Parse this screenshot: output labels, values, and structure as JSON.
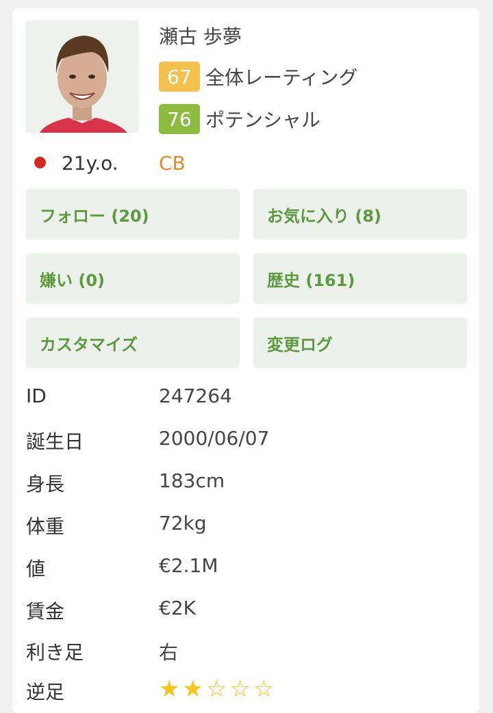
{
  "player": {
    "name": "瀬古 歩夢",
    "overall": "67",
    "overall_label": "全体レーティング",
    "potential": "76",
    "potential_label": "ポテンシャル",
    "age": "21y.o.",
    "position": "CB"
  },
  "colors": {
    "overall_badge": "#f2c14e",
    "potential_badge": "#8dbb3f",
    "position": "#e08a2e",
    "nation_dot": "#d2281e",
    "button_text": "#5c9a3e",
    "star": "#f5c518"
  },
  "buttons": [
    {
      "label": "フォロー (20)"
    },
    {
      "label": "お気に入り (8)"
    },
    {
      "label": "嫌い (0)"
    },
    {
      "label": "歴史 (161)"
    },
    {
      "label": "カスタマイズ"
    },
    {
      "label": "変更ログ"
    }
  ],
  "info": [
    {
      "label": "ID",
      "value": "247264"
    },
    {
      "label": "誕生日",
      "value": "2000/06/07"
    },
    {
      "label": "身長",
      "value": "183cm"
    },
    {
      "label": "体重",
      "value": "72kg"
    },
    {
      "label": "値",
      "value": "€2.1M"
    },
    {
      "label": "賃金",
      "value": "€2K"
    },
    {
      "label": "利き足",
      "value": "右"
    },
    {
      "label": "逆足",
      "value": ""
    }
  ],
  "weak_foot": {
    "rating": 2,
    "max": 5,
    "icon": "star-icon"
  }
}
